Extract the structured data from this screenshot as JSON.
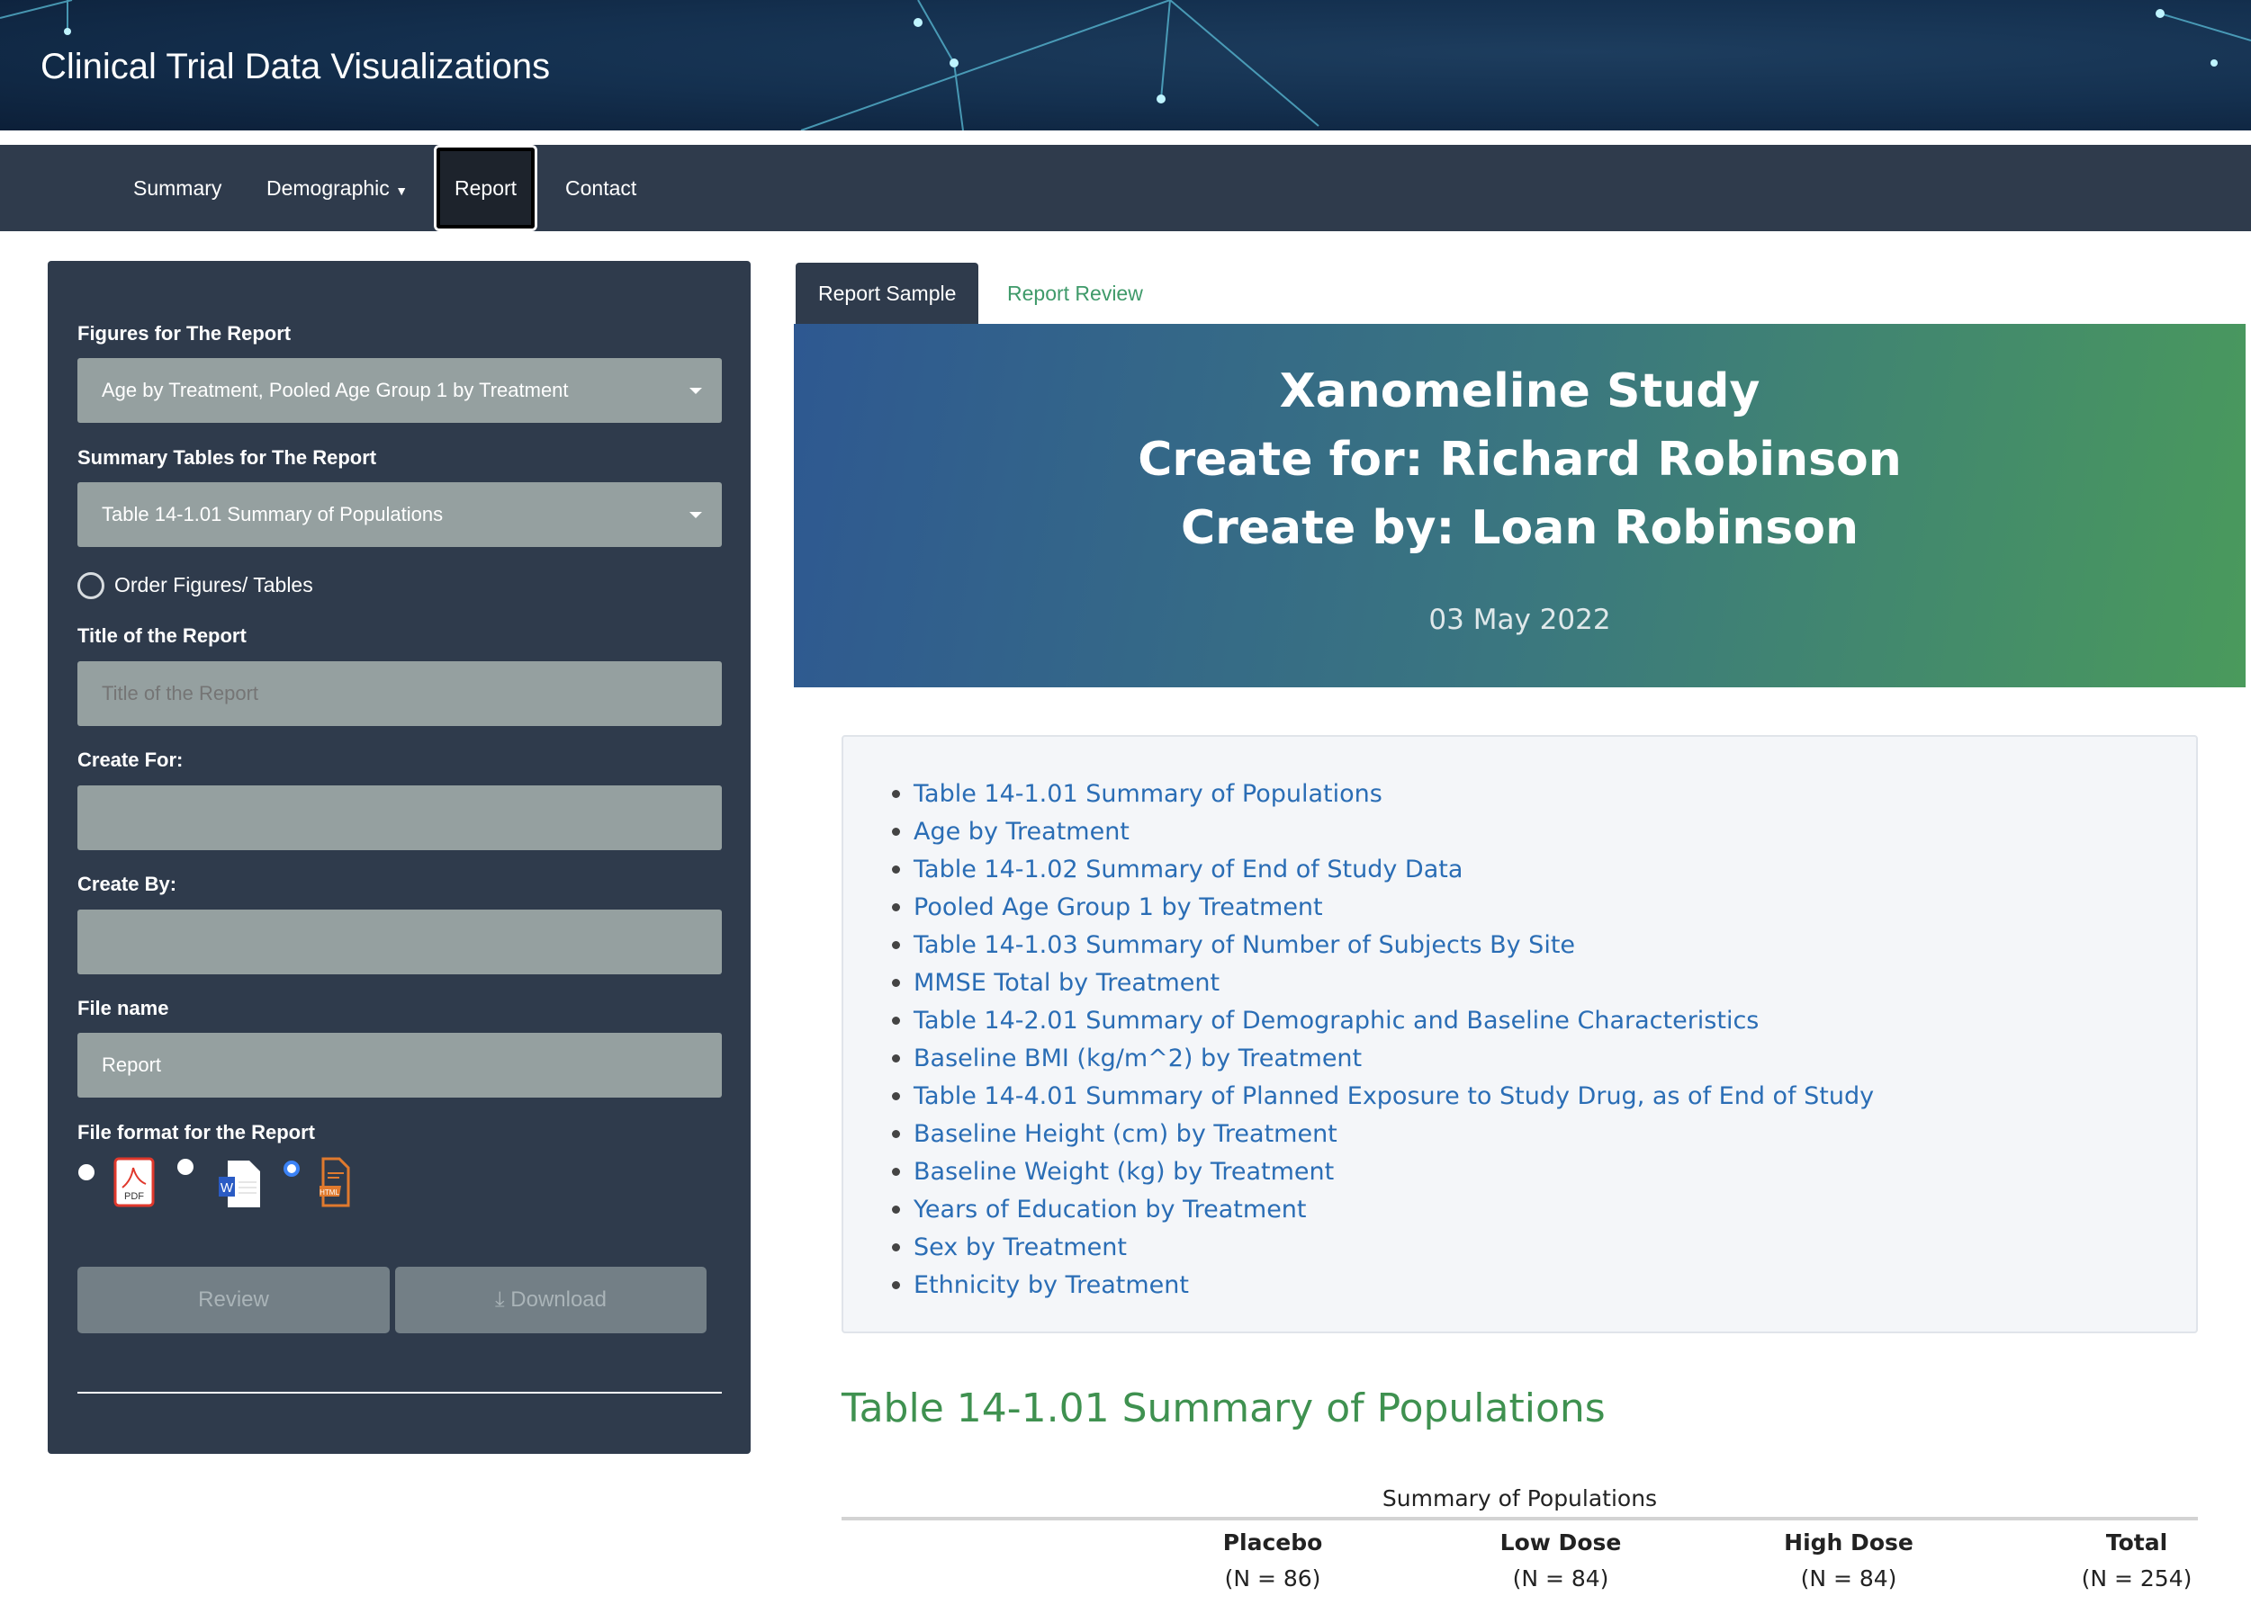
{
  "app": {
    "title": "Clinical Trial Data Visualizations"
  },
  "nav": [
    {
      "label": "Summary"
    },
    {
      "label": "Demographic"
    },
    {
      "label": "Report",
      "active": true
    },
    {
      "label": "Contact"
    }
  ],
  "sidebar": {
    "figures_label": "Figures for The Report",
    "figures_value": "Age by Treatment, Pooled Age Group 1 by Treatment",
    "tables_label": "Summary Tables for The Report",
    "tables_value": "Table 14-1.01 Summary of Populations",
    "order_label": "Order Figures/ Tables",
    "title_label": "Title of the Report",
    "title_placeholder": "Title of the Report",
    "create_for_label": "Create For:",
    "create_for_value": "",
    "create_by_label": "Create By:",
    "create_by_value": "",
    "file_name_label": "File name",
    "file_name_value": "Report",
    "format_label": "File format for the Report",
    "formats": [
      {
        "name": "PDF",
        "selected": false
      },
      {
        "name": "W",
        "selected": false
      },
      {
        "name": "HTML",
        "selected": true
      }
    ],
    "review_label": "Review",
    "download_label": "Download"
  },
  "tabs": [
    {
      "label": "Report Sample",
      "active": true
    },
    {
      "label": "Report Review"
    }
  ],
  "banner": {
    "study": "Xanomeline Study",
    "create_for": "Create for: Richard Robinson",
    "create_by": "Create by: Loan Robinson",
    "date": "03 May 2022"
  },
  "toc": [
    "Table 14-1.01 Summary of Populations",
    "Age by Treatment",
    "Table 14-1.02 Summary of End of Study Data",
    "Pooled Age Group 1 by Treatment",
    "Table 14-1.03 Summary of Number of Subjects By Site",
    "MMSE Total by Treatment",
    "Table 14-2.01 Summary of Demographic and Baseline Characteristics",
    "Baseline BMI (kg/m^2) by Treatment",
    "Table 14-4.01 Summary of Planned Exposure to Study Drug, as of End of Study",
    "Baseline Height (cm) by Treatment",
    "Baseline Weight (kg) by Treatment",
    "Years of Education by Treatment",
    "Sex by Treatment",
    "Ethnicity by Treatment"
  ],
  "section": {
    "heading": "Table 14-1.01 Summary of Populations",
    "caption": "Summary of Populations",
    "columns": [
      {
        "name": "Placebo",
        "n": "(N = 86)"
      },
      {
        "name": "Low Dose",
        "n": "(N = 84)"
      },
      {
        "name": "High Dose",
        "n": "(N = 84)"
      },
      {
        "name": "Total",
        "n": "(N = 254)"
      }
    ]
  },
  "colors": {
    "nav": "#2f3b4c",
    "link": "#2a6db5",
    "heading": "#3f9150",
    "selected_radio": "#3b82f6"
  }
}
